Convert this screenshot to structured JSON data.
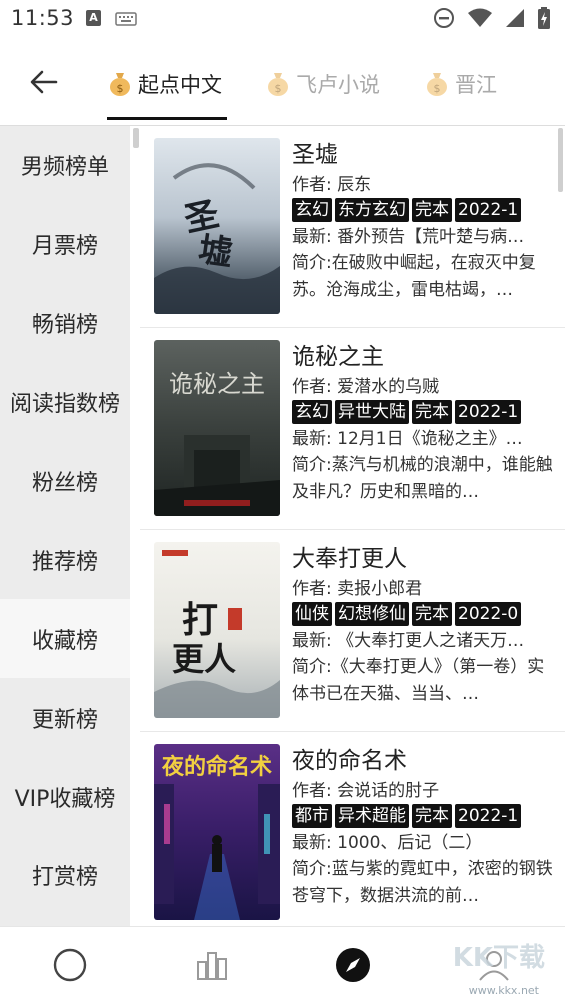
{
  "status_bar": {
    "time": "11:53",
    "notification_badge": "A"
  },
  "header": {
    "tabs": [
      {
        "label": "起点中文",
        "icon": "money-bag-icon",
        "active": true
      },
      {
        "label": "飞卢小说",
        "icon": "money-bag-icon",
        "active": false
      },
      {
        "label": "晋江",
        "icon": "money-bag-icon",
        "active": false
      }
    ]
  },
  "sidebar": {
    "items": [
      {
        "label": "男频榜单"
      },
      {
        "label": "月票榜"
      },
      {
        "label": "畅销榜"
      },
      {
        "label": "阅读指数榜"
      },
      {
        "label": "粉丝榜"
      },
      {
        "label": "推荐榜"
      },
      {
        "label": "收藏榜",
        "active": true
      },
      {
        "label": "更新榜"
      },
      {
        "label": "VIP收藏榜"
      },
      {
        "label": "打赏榜"
      }
    ]
  },
  "books": [
    {
      "title": "圣墟",
      "author": "作者: 辰东",
      "tags": [
        "玄幻",
        "东方玄幻",
        "完本",
        "2022-1"
      ],
      "latest": "最新: 番外预告【荒叶楚与病…",
      "intro": "简介:在破败中崛起，在寂灭中复苏。沧海成尘，雷电枯竭，…",
      "cover_text": "圣墟",
      "cover_colors": [
        "#c9d3dc",
        "#3d4a58"
      ]
    },
    {
      "title": "诡秘之主",
      "author": "作者: 爱潜水的乌贼",
      "tags": [
        "玄幻",
        "异世大陆",
        "完本",
        "2022-1"
      ],
      "latest": "最新: 12月1日《诡秘之主》…",
      "intro": "简介:蒸汽与机械的浪潮中，谁能触及非凡？历史和黑暗的…",
      "cover_text": "诡秘之主",
      "cover_colors": [
        "#4a4f4e",
        "#1c2220"
      ]
    },
    {
      "title": "大奉打更人",
      "author": "作者: 卖报小郎君",
      "tags": [
        "仙侠",
        "幻想修仙",
        "完本",
        "2022-0"
      ],
      "latest": "最新: 《大奉打更人之诸天万…",
      "intro": "简介:《大奉打更人》（第一卷）实体书已在天猫、当当、…",
      "cover_text": "打更人",
      "cover_colors": [
        "#f0efe9",
        "#9aa3a8"
      ]
    },
    {
      "title": "夜的命名术",
      "author": "作者: 会说话的肘子",
      "tags": [
        "都市",
        "异术超能",
        "完本",
        "2022-1"
      ],
      "latest": "最新: 1000、后记（二）",
      "intro": "简介:蓝与紫的霓虹中，浓密的钢铁苍穹下，数据洪流的前…",
      "cover_text": "夜的命名术",
      "cover_colors": [
        "#6a2a8a",
        "#1a1040"
      ]
    }
  ],
  "bottom_nav": [
    {
      "name": "home",
      "icon": "circle-icon"
    },
    {
      "name": "ranking",
      "icon": "bar-chart-icon"
    },
    {
      "name": "discover",
      "icon": "compass-icon",
      "active": true
    },
    {
      "name": "profile",
      "icon": "user-icon"
    }
  ],
  "watermark": {
    "text": "KK下载",
    "url": "www.kkx.net"
  }
}
